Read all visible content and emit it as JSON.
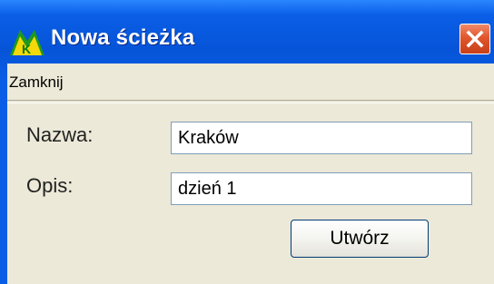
{
  "window": {
    "title": "Nowa ścieżka",
    "logo_icon": "app-logo-icon",
    "close_icon": "close-icon",
    "colors": {
      "titlebar": "#0a5ee6",
      "close": "#e0562c",
      "client": "#ece9d8"
    }
  },
  "menu": {
    "items": [
      {
        "label": "Zamknij"
      }
    ]
  },
  "form": {
    "name": {
      "label": "Nazwa:",
      "value": "Kraków"
    },
    "description": {
      "label": "Opis:",
      "value": "dzień 1"
    },
    "submit_label": "Utwórz"
  }
}
